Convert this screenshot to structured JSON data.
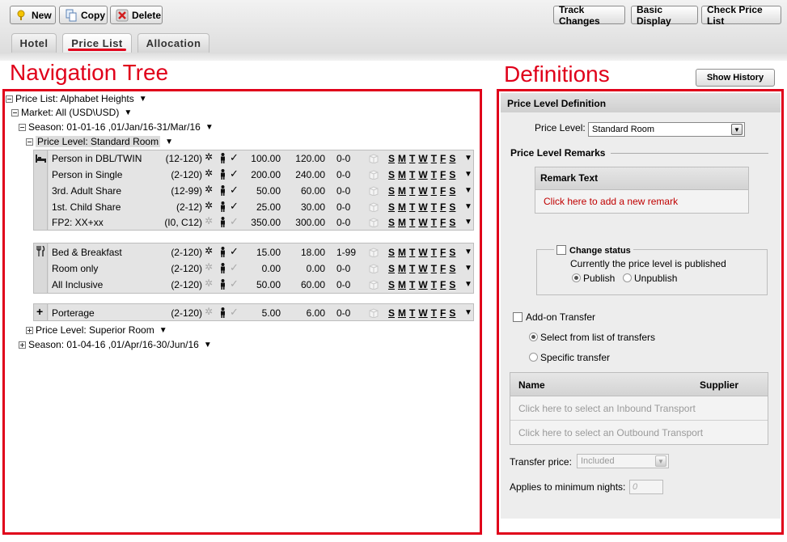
{
  "toolbar": {
    "new_label": "New",
    "copy_label": "Copy",
    "delete_label": "Delete",
    "track_changes_label": "Track Changes",
    "basic_display_label": "Basic Display",
    "check_price_list_label": "Check Price List"
  },
  "tabs": [
    {
      "label": "Hotel"
    },
    {
      "label": "Price List"
    },
    {
      "label": "Allocation"
    }
  ],
  "annotations": {
    "navigation": "Navigation Tree",
    "definitions": "Definitions"
  },
  "tree": {
    "price_list": "Price List: Alphabet Heights",
    "market": "Market: All (USD\\USD)",
    "season1": "Season: 01-01-16 ,01/Jan/16-31/Mar/16",
    "price_level1": "Price Level: Standard Room",
    "price_level2": "Price Level: Superior Room",
    "season2": "Season: 01-04-16 ,01/Apr/16-30/Jun/16",
    "days": [
      "S",
      "M",
      "T",
      "W",
      "T",
      "F",
      "S"
    ],
    "rooms": [
      {
        "name": "Person in DBL/TWIN",
        "ages": "(12-120)",
        "v1": "100.00",
        "v2": "120.00",
        "nights": "0-0"
      },
      {
        "name": "Person in Single",
        "ages": "(2-120)",
        "v1": "200.00",
        "v2": "240.00",
        "nights": "0-0"
      },
      {
        "name": "3rd. Adult Share",
        "ages": "(12-99)",
        "v1": "50.00",
        "v2": "60.00",
        "nights": "0-0"
      },
      {
        "name": "1st. Child Share",
        "ages": "(2-12)",
        "v1": "25.00",
        "v2": "30.00",
        "nights": "0-0"
      },
      {
        "name": "FP2: XX+xx",
        "ages": "(I0, C12)",
        "v1": "350.00",
        "v2": "300.00",
        "nights": "0-0"
      }
    ],
    "meals": [
      {
        "name": "Bed & Breakfast",
        "ages": "(2-120)",
        "v1": "15.00",
        "v2": "18.00",
        "nights": "1-99"
      },
      {
        "name": "Room only",
        "ages": "(2-120)",
        "v1": "0.00",
        "v2": "0.00",
        "nights": "0-0"
      },
      {
        "name": "All Inclusive",
        "ages": "(2-120)",
        "v1": "50.00",
        "v2": "60.00",
        "nights": "0-0"
      }
    ],
    "extras": [
      {
        "name": "Porterage",
        "ages": "(2-120)",
        "v1": "5.00",
        "v2": "6.00",
        "nights": "0-0"
      }
    ]
  },
  "definitions": {
    "show_history_label": "Show History",
    "title": "Price Level Definition",
    "price_level_label": "Price Level:",
    "price_level_value": "Standard Room",
    "remarks_title": "Price Level Remarks",
    "remark_header": "Remark Text",
    "remark_add": "Click here to add a new remark",
    "change_status_label": "Change status",
    "status_text": "Currently the price level is published",
    "publish_label": "Publish",
    "unpublish_label": "Unpublish",
    "addon_transfer_label": "Add-on Transfer",
    "select_from_list_label": "Select from list of transfers",
    "specific_transfer_label": "Specific transfer",
    "col_name": "Name",
    "col_supplier": "Supplier",
    "inbound_placeholder": "Click here to select an Inbound Transport",
    "outbound_placeholder": "Click here to select an Outbound Transport",
    "transfer_price_label": "Transfer price:",
    "transfer_price_value": "Included",
    "min_nights_label": "Applies to minimum nights:",
    "min_nights_placeholder": "0"
  },
  "colors": {
    "annotation_red": "#e0001a",
    "remark_link": "#c00000",
    "panel_bg": "#ededed"
  }
}
